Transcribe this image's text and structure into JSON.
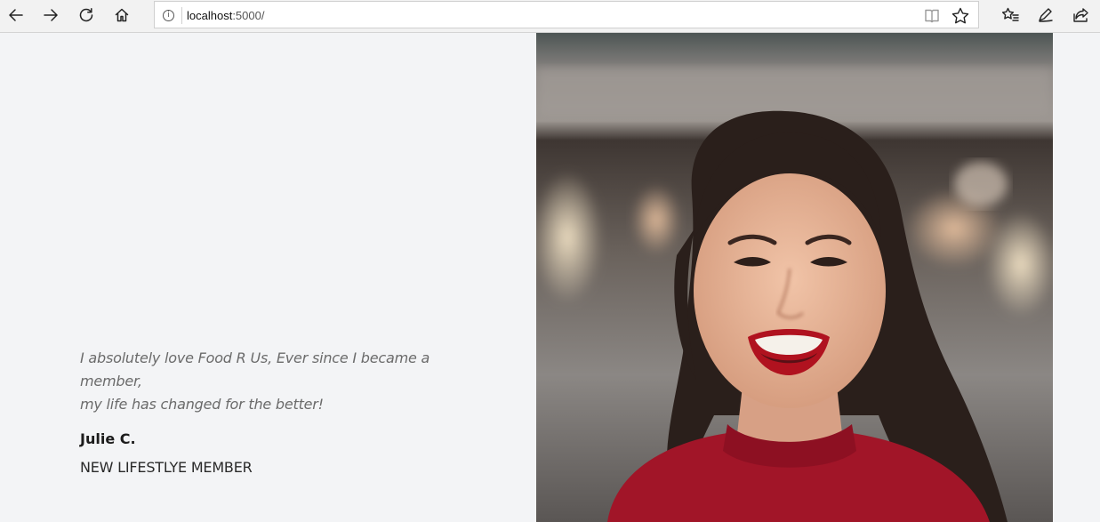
{
  "browser": {
    "url_host": "localhost",
    "url_rest": ":5000/",
    "info_icon": "i"
  },
  "testimonial": {
    "quote_line1": "I absolutely love Food R Us, Ever since I became a member,",
    "quote_line2": "my life has changed for the better!",
    "author": "Julie C.",
    "role": "NEW LIFESTLYE MEMBER"
  },
  "colors": {
    "page_background": "#f3f4f6",
    "quote_text": "#6b6b6b",
    "author_text": "#1c1c1c"
  },
  "icons": [
    "back-arrow-icon",
    "forward-arrow-icon",
    "refresh-icon",
    "home-icon",
    "info-icon",
    "reading-view-icon",
    "favorite-star-icon",
    "favorites-list-icon",
    "pen-notes-icon",
    "share-icon"
  ]
}
